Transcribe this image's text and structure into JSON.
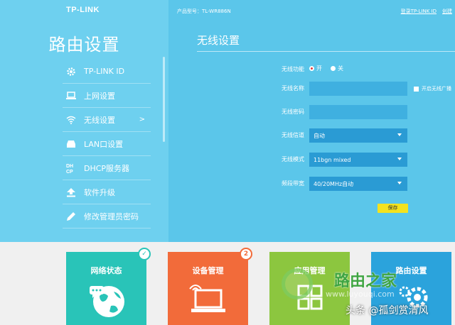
{
  "brand": {
    "logo": "TP-LINK"
  },
  "sidebar": {
    "title": "路由设置",
    "items": [
      {
        "label": "TP-LINK ID",
        "icon": "gear-icon"
      },
      {
        "label": "上网设置",
        "icon": "laptop-icon"
      },
      {
        "label": "无线设置",
        "icon": "wifi-icon",
        "arrow": ">"
      },
      {
        "label": "LAN口设置",
        "icon": "router-icon"
      },
      {
        "label": "DHCP服务器",
        "icon": "dhcp-icon"
      },
      {
        "label": "软件升级",
        "icon": "upload-icon"
      },
      {
        "label": "修改管理员密码",
        "icon": "pencil-icon"
      }
    ]
  },
  "header": {
    "model": "产品型号：TL-WR886N",
    "link_login": "登录TP-LINK ID",
    "link_create": "创建"
  },
  "main": {
    "section_title": "无线设置",
    "wireless_func": {
      "label": "无线功能",
      "on": "开",
      "off": "关"
    },
    "ssid": {
      "label": "无线名称",
      "value": "",
      "broadcast": "开启无线广播"
    },
    "password": {
      "label": "无线密码",
      "value": ""
    },
    "channel": {
      "label": "无线信道",
      "value": "自动"
    },
    "mode": {
      "label": "无线模式",
      "value": "11bgn mixed"
    },
    "bandwidth": {
      "label": "频段带宽",
      "value": "40/20MHz自动"
    },
    "save": "保存"
  },
  "tiles": [
    {
      "label": "网络状态",
      "color": "#29c4b8",
      "badge": "✓"
    },
    {
      "label": "设备管理",
      "color": "#f26b3a",
      "badge": "2"
    },
    {
      "label": "应用管理",
      "color": "#8cc63f"
    },
    {
      "label": "路由设置",
      "color": "#2ba3dc"
    }
  ],
  "watermark": {
    "site_name": "路由之家",
    "site_url": "www.luyouqi.com",
    "credit": "头条 @孤剑赏清风"
  }
}
